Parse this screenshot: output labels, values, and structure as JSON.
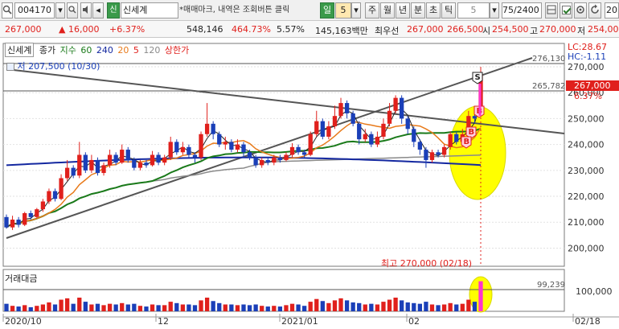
{
  "toolbar": {
    "code": "004170",
    "name_badge": "신",
    "name": "신세계",
    "hint": "*매매마크, 내역은 조회버튼 클릭",
    "period_unit": "일",
    "period_value": "5",
    "period_tabs": [
      "주",
      "월",
      "년",
      "분",
      "초",
      "틱"
    ],
    "tick_value": "5",
    "range": "75/2400",
    "right_value": "20"
  },
  "quote": {
    "price": "267,000",
    "change": "▲ 16,000",
    "change_pct": "+6.37%",
    "volume": "548,146",
    "volume_pct": "464.73%",
    "turnover": "5.57%",
    "amount": "145,163백만",
    "ask_label": "최우선",
    "ask": "267,000",
    "bid": "266,500",
    "open_label": "시",
    "open": "254,500",
    "high_label": "고",
    "high": "270,000",
    "low_label": "저",
    "low": "254,000"
  },
  "legend": {
    "title": "신세계",
    "items": [
      "종가",
      "지수",
      "60",
      "240",
      "20",
      "5",
      "120",
      "상한가"
    ],
    "low_note": "저 207,500 (10/30)",
    "high_note": "최고 270,000 (02/18)",
    "lc": "LC:28.67",
    "hc": "HC:-1.11",
    "price_badge": "267,000",
    "pct_badge": "6.37%",
    "volume_title": "거래대금",
    "volume_mark": "99,239",
    "line_upper": "276,130",
    "line_mid": "265,782",
    "marks": [
      "S",
      "B",
      "B",
      "B"
    ]
  },
  "colors": {
    "up": "#e0201c",
    "down": "#1a3fb8",
    "ma5": "#e0201c",
    "ma20": "#e87a1a",
    "ma60": "#1a7a1a",
    "ma120": "#8a8a8a",
    "ma240": "#1428a0",
    "highlight": "#ffff00",
    "marker": "#ff33cc"
  },
  "chart_data": {
    "type": "candlestick",
    "x_tick_labels": [
      "2020/10",
      "12",
      "2021/01",
      "02",
      "02/18"
    ],
    "y_ticks": [
      200000,
      210000,
      220000,
      230000,
      240000,
      250000,
      260000,
      270000
    ],
    "ylim": [
      193000,
      279000
    ],
    "volume_ticks": [
      "100,000"
    ],
    "candles": [
      [
        212000,
        208000,
        213000,
        207500,
        0.55
      ],
      [
        208000,
        211000,
        212500,
        207000,
        0.4
      ],
      [
        211000,
        209000,
        212000,
        208000,
        0.35
      ],
      [
        209000,
        213500,
        214000,
        208500,
        0.45
      ],
      [
        213500,
        212000,
        214500,
        211000,
        0.3
      ],
      [
        212000,
        215000,
        215500,
        211500,
        0.4
      ],
      [
        215000,
        218000,
        219000,
        214000,
        0.5
      ],
      [
        218000,
        222000,
        223000,
        217000,
        0.65
      ],
      [
        222000,
        219000,
        223000,
        218000,
        0.5
      ],
      [
        219000,
        227000,
        228500,
        218500,
        0.85
      ],
      [
        227000,
        231000,
        234000,
        226000,
        0.95
      ],
      [
        231000,
        228000,
        232000,
        227000,
        0.55
      ],
      [
        228000,
        236000,
        241000,
        227000,
        1.0
      ],
      [
        236000,
        230000,
        237000,
        229000,
        0.7
      ],
      [
        230000,
        234000,
        236000,
        229000,
        0.5
      ],
      [
        234000,
        229000,
        235000,
        228000,
        0.55
      ],
      [
        229000,
        232000,
        233000,
        228000,
        0.45
      ],
      [
        232000,
        236000,
        238000,
        231000,
        0.55
      ],
      [
        236000,
        233000,
        237000,
        232000,
        0.5
      ],
      [
        233000,
        238000,
        240000,
        232500,
        0.6
      ],
      [
        238000,
        234000,
        239000,
        233000,
        0.5
      ],
      [
        234000,
        231000,
        235000,
        230000,
        0.55
      ],
      [
        231000,
        233000,
        234000,
        230000,
        0.4
      ],
      [
        233000,
        232000,
        234000,
        231000,
        0.35
      ],
      [
        232000,
        236000,
        237500,
        231500,
        0.5
      ],
      [
        236000,
        233000,
        237000,
        232000,
        0.45
      ],
      [
        233000,
        235000,
        236000,
        232000,
        0.45
      ],
      [
        235000,
        241000,
        243000,
        234000,
        0.7
      ],
      [
        241000,
        237000,
        242000,
        236000,
        0.6
      ],
      [
        237000,
        239000,
        241000,
        236000,
        0.5
      ],
      [
        239000,
        236000,
        240000,
        235000,
        0.5
      ],
      [
        236000,
        235000,
        237000,
        233000,
        0.45
      ],
      [
        235000,
        244000,
        245000,
        234000,
        0.8
      ],
      [
        244000,
        248000,
        256000,
        243000,
        1.0
      ],
      [
        248000,
        244000,
        249000,
        242000,
        0.75
      ],
      [
        244000,
        240000,
        245000,
        239000,
        0.6
      ],
      [
        240000,
        241000,
        243000,
        238000,
        0.5
      ],
      [
        241000,
        238000,
        242000,
        237000,
        0.5
      ],
      [
        238000,
        240000,
        242000,
        237000,
        0.45
      ],
      [
        240000,
        237000,
        241000,
        235000,
        0.5
      ],
      [
        237000,
        235000,
        238000,
        234000,
        0.45
      ],
      [
        235000,
        232000,
        236000,
        231000,
        0.5
      ],
      [
        232000,
        234000,
        235000,
        231000,
        0.4
      ],
      [
        234000,
        233000,
        235000,
        232000,
        0.35
      ],
      [
        233000,
        235000,
        236000,
        232000,
        0.4
      ],
      [
        235000,
        234000,
        236000,
        233000,
        0.35
      ],
      [
        234000,
        236000,
        237000,
        233500,
        0.45
      ],
      [
        236000,
        239000,
        240500,
        235000,
        0.55
      ],
      [
        239000,
        237000,
        240000,
        236000,
        0.5
      ],
      [
        237000,
        236000,
        238000,
        235000,
        0.4
      ],
      [
        236000,
        244000,
        245000,
        235500,
        0.7
      ],
      [
        244000,
        249000,
        253000,
        243000,
        0.9
      ],
      [
        249000,
        243000,
        250000,
        242000,
        0.75
      ],
      [
        243000,
        247000,
        249000,
        242000,
        0.6
      ],
      [
        247000,
        251000,
        255000,
        246000,
        0.8
      ],
      [
        251000,
        256000,
        258000,
        250000,
        0.95
      ],
      [
        256000,
        252000,
        257000,
        250000,
        0.8
      ],
      [
        252000,
        248000,
        253000,
        247000,
        0.65
      ],
      [
        248000,
        242000,
        249000,
        240000,
        0.6
      ],
      [
        242000,
        244000,
        246000,
        241000,
        0.5
      ],
      [
        244000,
        240000,
        245000,
        239000,
        0.55
      ],
      [
        240000,
        243000,
        245000,
        239000,
        0.5
      ],
      [
        243000,
        248000,
        250000,
        242000,
        0.7
      ],
      [
        248000,
        253000,
        256000,
        247000,
        0.85
      ],
      [
        253000,
        258000,
        259000,
        252000,
        1.0
      ],
      [
        258000,
        250000,
        259000,
        248000,
        0.8
      ],
      [
        250000,
        246000,
        251000,
        244000,
        0.65
      ],
      [
        246000,
        241000,
        247000,
        239000,
        0.6
      ],
      [
        241000,
        238000,
        242000,
        236000,
        0.55
      ],
      [
        238000,
        234000,
        239000,
        231000,
        0.7
      ],
      [
        234000,
        237000,
        238000,
        233000,
        0.5
      ],
      [
        237000,
        236000,
        238000,
        235000,
        0.45
      ],
      [
        236000,
        239000,
        240000,
        235000,
        0.5
      ],
      [
        239000,
        244000,
        245000,
        238000,
        0.6
      ],
      [
        244000,
        241000,
        245000,
        240000,
        0.5
      ],
      [
        241000,
        244000,
        246000,
        240000,
        0.55
      ],
      [
        244000,
        251000,
        253000,
        243000,
        0.85
      ],
      [
        251000,
        250000,
        253000,
        248000,
        0.7
      ],
      [
        254500,
        267000,
        270000,
        254000,
        2.2
      ]
    ]
  }
}
